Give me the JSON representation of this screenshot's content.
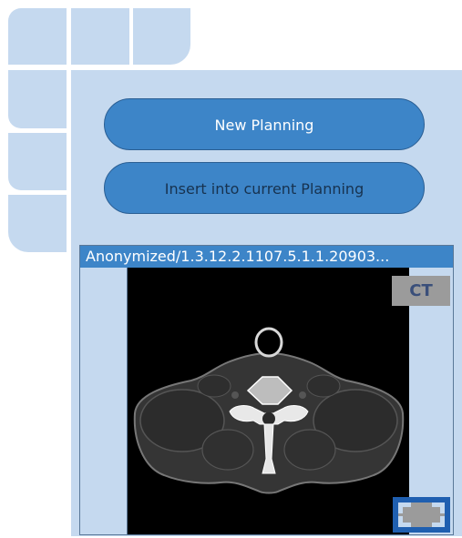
{
  "logo": {
    "name": "tile-logo-icon"
  },
  "panel": {
    "new_planning_label": "New Planning",
    "insert_planning_label": "Insert into current Planning"
  },
  "viewer": {
    "title": "Anonymized/1.3.12.2.1107.5.1.1.20903...",
    "modality_badge": "CT",
    "expand_icon": "expand-fullscreen-icon",
    "image_icon": "ct-axial-slice-image"
  },
  "colors": {
    "panel_bg": "#c5d9ef",
    "accent": "#3d85c8",
    "badge_bg": "#9b9b9b"
  }
}
